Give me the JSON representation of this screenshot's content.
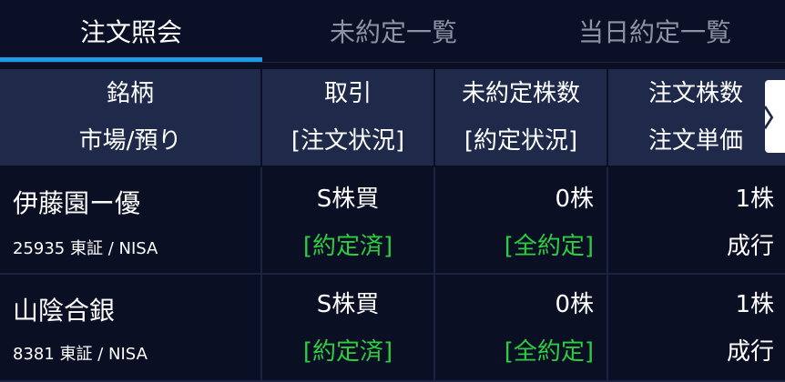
{
  "tabs": [
    {
      "label": "注文照会",
      "active": true
    },
    {
      "label": "未約定一覧",
      "active": false
    },
    {
      "label": "当日約定一覧",
      "active": false
    }
  ],
  "columns": [
    {
      "line1": "銘柄",
      "line2": "市場/預り"
    },
    {
      "line1": "取引",
      "line2": "[注文状況]"
    },
    {
      "line1": "未約定株数",
      "line2": "[約定状況]"
    },
    {
      "line1": "注文株数",
      "line2": "注文単価"
    }
  ],
  "scroll_icon": "chevron-right-icon",
  "scroll_glyph": "〉",
  "rows": [
    {
      "name": "伊藤園ー優",
      "market": "25935 東証 / NISA",
      "trade": "S株買",
      "order_status": "[約定済]",
      "unfilled": "0株",
      "fill_status": "[全約定]",
      "order_qty": "1株",
      "order_price": "成行"
    },
    {
      "name": "山陰合銀",
      "market": "8381 東証 / NISA",
      "trade": "S株買",
      "order_status": "[約定済]",
      "unfilled": "0株",
      "fill_status": "[全約定]",
      "order_qty": "1株",
      "order_price": "成行"
    }
  ],
  "colors": {
    "background": "#0a0f24",
    "header_bg": "#1f2a4a",
    "accent": "#1e9be6",
    "status_green": "#2ecc40",
    "inactive_tab": "#8d93a5"
  }
}
